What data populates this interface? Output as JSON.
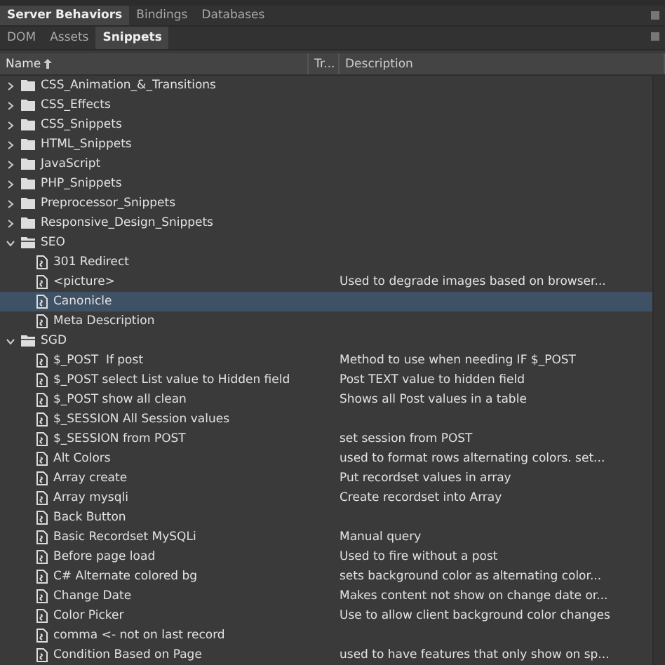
{
  "panel_tabs": [
    {
      "label": "Server Behaviors",
      "selected": true
    },
    {
      "label": "Bindings",
      "selected": false
    },
    {
      "label": "Databases",
      "selected": false
    }
  ],
  "sub_tabs": [
    {
      "label": "DOM",
      "selected": false
    },
    {
      "label": "Assets",
      "selected": false
    },
    {
      "label": "Snippets",
      "selected": true
    }
  ],
  "columns": [
    {
      "label": "Name",
      "sorted": true
    },
    {
      "label": "Tr...",
      "sorted": false
    },
    {
      "label": "Description",
      "sorted": false
    }
  ],
  "tree": [
    {
      "kind": "folder",
      "name": "CSS_Animation_&_Transitions",
      "expanded": false,
      "selected": false
    },
    {
      "kind": "folder",
      "name": "CSS_Effects",
      "expanded": false,
      "selected": false
    },
    {
      "kind": "folder",
      "name": "CSS_Snippets",
      "expanded": false,
      "selected": false
    },
    {
      "kind": "folder",
      "name": "HTML_Snippets",
      "expanded": false,
      "selected": false
    },
    {
      "kind": "folder",
      "name": "JavaScript",
      "expanded": false,
      "selected": false
    },
    {
      "kind": "folder",
      "name": "PHP_Snippets",
      "expanded": false,
      "selected": false
    },
    {
      "kind": "folder",
      "name": "Preprocessor_Snippets",
      "expanded": false,
      "selected": false
    },
    {
      "kind": "folder",
      "name": "Responsive_Design_Snippets",
      "expanded": false,
      "selected": false
    },
    {
      "kind": "folder",
      "name": "SEO",
      "expanded": true,
      "selected": false,
      "children": [
        {
          "kind": "snippet",
          "name": "301 Redirect",
          "selected": false
        },
        {
          "kind": "snippet",
          "name": "<picture>",
          "description": "Used to degrade images based on browser...",
          "selected": false
        },
        {
          "kind": "snippet",
          "name": "Canonicle",
          "selected": true
        },
        {
          "kind": "snippet",
          "name": "Meta Description",
          "selected": false
        }
      ]
    },
    {
      "kind": "folder",
      "name": "SGD",
      "expanded": true,
      "selected": false,
      "children": [
        {
          "kind": "snippet",
          "name": "$_POST  If post",
          "description": "Method to use when needing IF $_POST",
          "selected": false
        },
        {
          "kind": "snippet",
          "name": "$_POST select List value to Hidden field",
          "description": "Post TEXT value to hidden field",
          "selected": false
        },
        {
          "kind": "snippet",
          "name": "$_POST show all clean",
          "description": "Shows all Post values in a table",
          "selected": false
        },
        {
          "kind": "snippet",
          "name": "$_SESSION All Session values",
          "selected": false
        },
        {
          "kind": "snippet",
          "name": "$_SESSION from POST",
          "description": "set session from POST",
          "selected": false
        },
        {
          "kind": "snippet",
          "name": "Alt Colors",
          "description": "used to format rows alternating colors. set...",
          "selected": false
        },
        {
          "kind": "snippet",
          "name": "Array create",
          "description": "Put recordset values in array",
          "selected": false
        },
        {
          "kind": "snippet",
          "name": "Array mysqli",
          "description": "Create recordset into Array",
          "selected": false
        },
        {
          "kind": "snippet",
          "name": "Back Button",
          "selected": false
        },
        {
          "kind": "snippet",
          "name": "Basic Recordset MySQLi",
          "description": "Manual query",
          "selected": false
        },
        {
          "kind": "snippet",
          "name": "Before page load",
          "description": "Used to fire without a post",
          "selected": false
        },
        {
          "kind": "snippet",
          "name": "C# Alternate colored bg",
          "description": "sets background color as alternating color...",
          "selected": false
        },
        {
          "kind": "snippet",
          "name": "Change Date",
          "description": "Makes content not show on change date or...",
          "selected": false
        },
        {
          "kind": "snippet",
          "name": "Color Picker",
          "description": "Use to allow client background color changes",
          "selected": false
        },
        {
          "kind": "snippet",
          "name": "comma <- not on last record",
          "selected": false
        },
        {
          "kind": "snippet",
          "name": "Condition Based on Page",
          "description": "used to have features that only show on sp...",
          "selected": false
        }
      ]
    }
  ]
}
